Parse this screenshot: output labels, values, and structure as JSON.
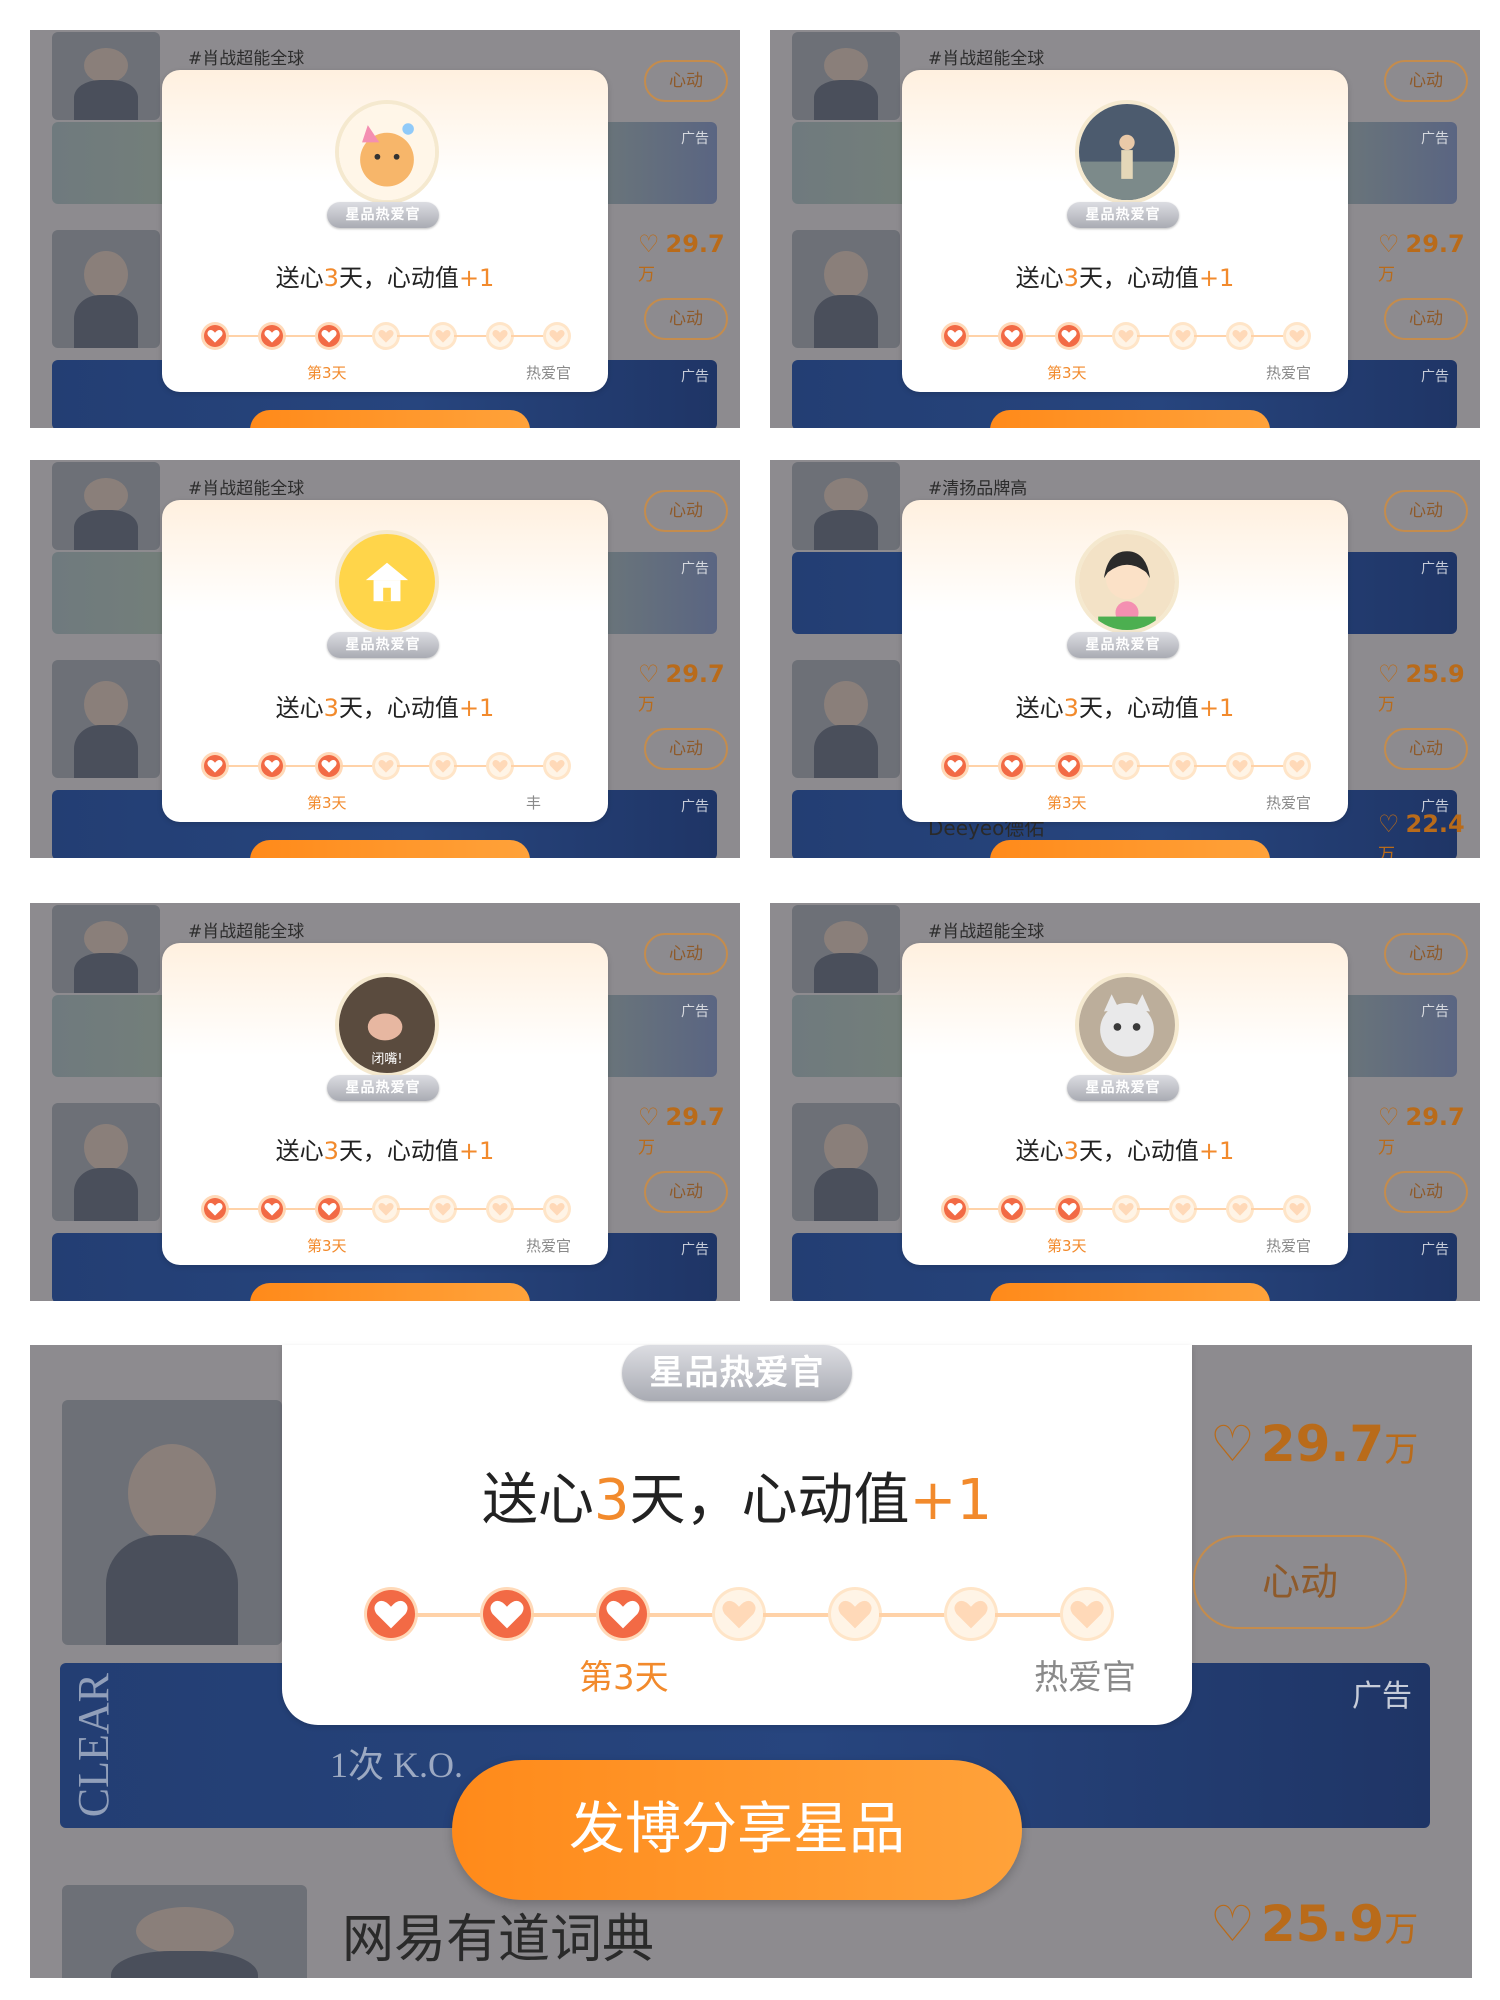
{
  "cards": [
    {
      "id": "p1",
      "avatar": "cat-party-avatar",
      "badge": "星品热爱官",
      "headline": {
        "prefix": "送心",
        "num": "3",
        "mid": "天，心动值",
        "plus": "+1"
      },
      "day_label": "第3天",
      "end_label": "热爱官",
      "filled": 3,
      "total": 7,
      "bg": {
        "hashtag": "#肖战超能全球",
        "likes_value": "29.7",
        "likes_unit": "万",
        "follow": "心动",
        "ad": "广告"
      }
    },
    {
      "id": "p2",
      "avatar": "girl-photo-avatar",
      "badge": "星品热爱官",
      "headline": {
        "prefix": "送心",
        "num": "3",
        "mid": "天，心动值",
        "plus": "+1"
      },
      "day_label": "第3天",
      "end_label": "热爱官",
      "filled": 3,
      "total": 7,
      "bg": {
        "hashtag": "#肖战超能全球",
        "likes_value": "29.7",
        "likes_unit": "万",
        "follow": "心动",
        "ad": "广告"
      }
    },
    {
      "id": "p3",
      "avatar": "yellow-house-avatar",
      "badge": "星品热爱官",
      "headline": {
        "prefix": "送心",
        "num": "3",
        "mid": "天，心动值",
        "plus": "+1"
      },
      "day_label": "第3天",
      "end_label": "丰",
      "filled": 3,
      "total": 7,
      "bg": {
        "hashtag": "#肖战超能全球",
        "likes_value": "29.7",
        "likes_unit": "万",
        "follow": "心动",
        "ad": "广告"
      }
    },
    {
      "id": "p4",
      "avatar": "cartoon-girl-avatar",
      "badge": "星品热爱官",
      "headline": {
        "prefix": "送心",
        "num": "3",
        "mid": "天，心动值",
        "plus": "+1"
      },
      "day_label": "第3天",
      "end_label": "热爱官",
      "filled": 3,
      "total": 7,
      "bg": {
        "hashtag": "#清扬品牌高",
        "likes_value": "25.9",
        "likes_unit": "万",
        "likes2_value": "22.4",
        "likes2_unit": "万",
        "name": "Deeyeo德佑",
        "follow": "心动",
        "ad": "广告"
      }
    },
    {
      "id": "p5",
      "avatar": "dark-photo-avatar",
      "avatar_caption": "闭嘴!",
      "badge": "星品热爱官",
      "headline": {
        "prefix": "送心",
        "num": "3",
        "mid": "天，心动值",
        "plus": "+1"
      },
      "day_label": "第3天",
      "end_label": "热爱官",
      "filled": 3,
      "total": 7,
      "bg": {
        "hashtag": "#肖战超能全球",
        "likes_value": "29.7",
        "likes_unit": "万",
        "follow": "心动",
        "ad": "广告"
      }
    },
    {
      "id": "p6",
      "avatar": "white-cat-avatar",
      "badge": "星品热爱官",
      "headline": {
        "prefix": "送心",
        "num": "3",
        "mid": "天，心动值",
        "plus": "+1"
      },
      "day_label": "第3天",
      "end_label": "热爱官",
      "filled": 3,
      "total": 7,
      "bg": {
        "hashtag": "#肖战超能全球",
        "likes_value": "29.7",
        "likes_unit": "万",
        "follow": "心动",
        "ad": "广告"
      }
    }
  ],
  "zoom": {
    "badge": "星品热爱官",
    "headline": {
      "prefix": "送心",
      "num": "3",
      "mid": "天，心动值",
      "plus": "+1"
    },
    "day_label": "第3天",
    "end_label": "热爱官",
    "filled": 3,
    "total": 7,
    "share_button": "发博分享星品",
    "likes_value": "29.7",
    "likes_unit": "万",
    "likes2_value": "25.9",
    "likes2_unit": "万",
    "follow": "心动",
    "ad": "广告",
    "ad_brand": "CLEAR",
    "ad_product": "1次 K.O.",
    "brand_name": "网易有道词典"
  },
  "colors": {
    "accent": "#f28a2c",
    "heart_on": "#f26a45",
    "heart_off": "#fff4e6",
    "button": "#ff8a1a",
    "badge": "#b8bac1"
  }
}
